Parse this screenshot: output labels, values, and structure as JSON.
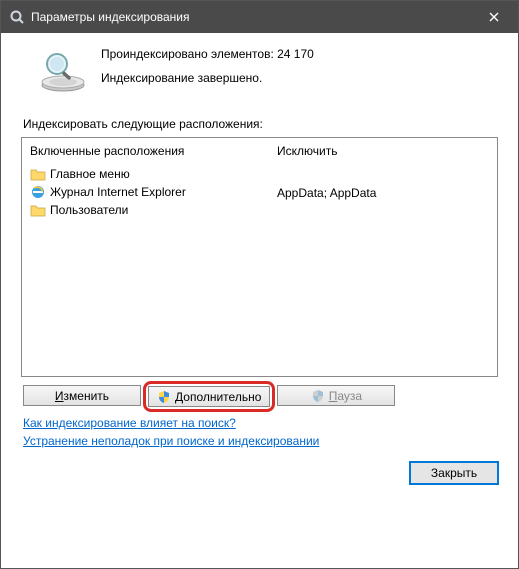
{
  "titlebar": {
    "title": "Параметры индексирования"
  },
  "status": {
    "line1": "Проиндексировано элементов: 24 170",
    "line2": "Индексирование завершено."
  },
  "section_label": "Индексировать следующие расположения:",
  "columns": {
    "included_header": "Включенные расположения",
    "excluded_header": "Исключить"
  },
  "included": [
    {
      "icon": "folder",
      "label": "Главное меню"
    },
    {
      "icon": "ie",
      "label": "Журнал Internet Explorer"
    },
    {
      "icon": "folder",
      "label": "Пользователи"
    }
  ],
  "excluded_text": "AppData; AppData",
  "buttons": {
    "modify": "Изменить",
    "modify_u": "И",
    "advanced": "Дополнительно",
    "advanced_u": "Д",
    "pause": "Пауза",
    "pause_u": "П"
  },
  "links": {
    "l1": "Как индексирование влияет на поиск?",
    "l2": "Устранение неполадок при поиске и индексировании"
  },
  "footer": {
    "close": "Закрыть"
  }
}
